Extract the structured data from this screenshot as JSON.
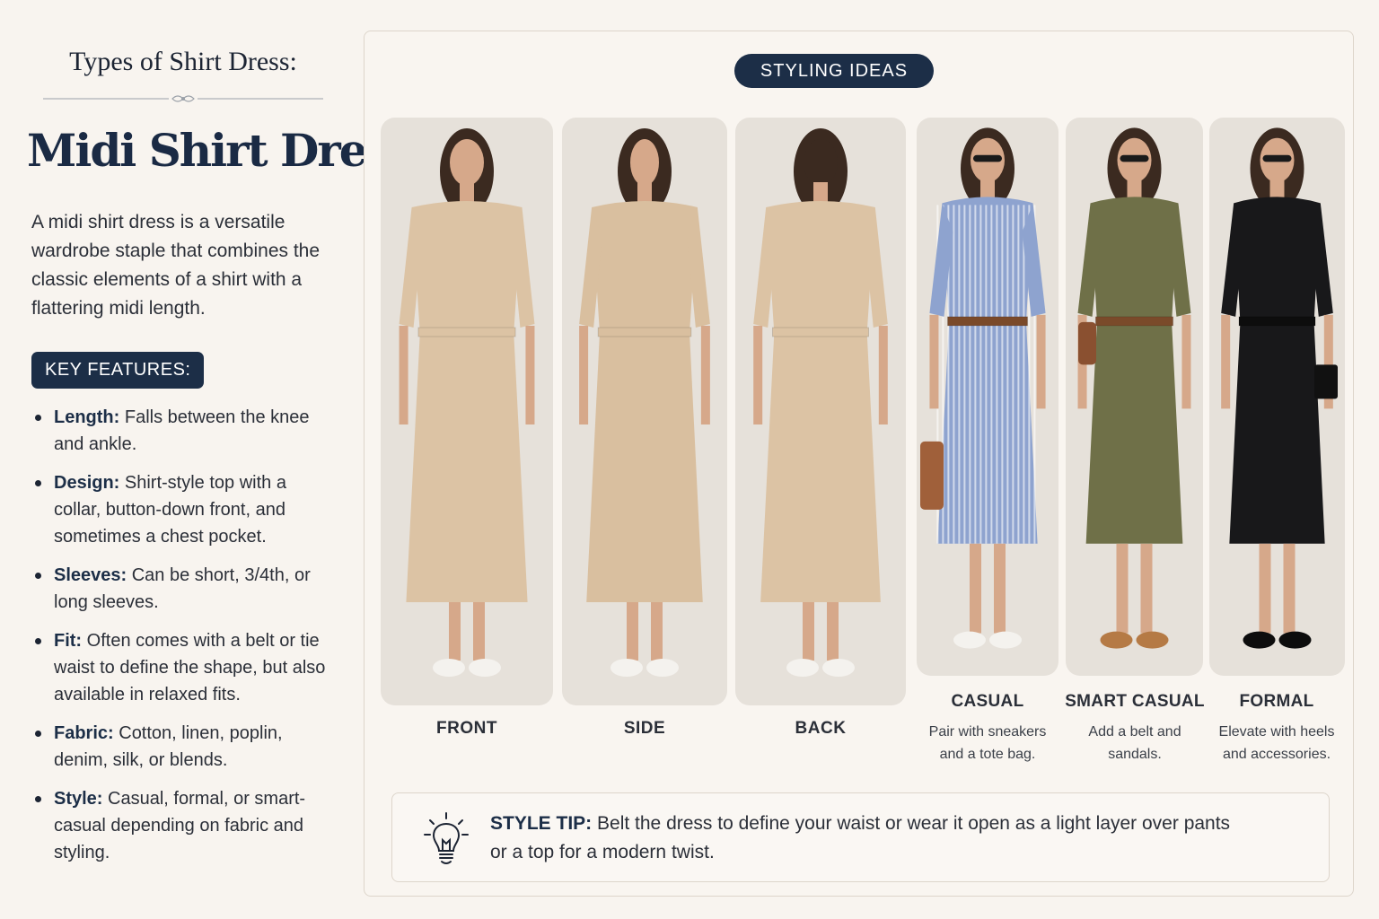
{
  "left": {
    "eyebrow": "Types of Shirt Dress:",
    "title": "Midi Shirt Dress",
    "intro": "A midi shirt dress is a versatile wardrobe staple that combines the classic elements of a shirt with a flattering midi length.",
    "key_features_label": "KEY FEATURES:",
    "features": [
      {
        "term": "Length:",
        "text": " Falls between the knee and ankle."
      },
      {
        "term": "Design:",
        "text": " Shirt-style top with a collar, button-down front, and sometimes a chest pocket."
      },
      {
        "term": "Sleeves:",
        "text": " Can be short, 3/4th, or long sleeves."
      },
      {
        "term": "Fit:",
        "text": " Often comes with a belt or tie waist to define the shape, but also available in relaxed fits."
      },
      {
        "term": "Fabric:",
        "text": " Cotton, linen, poplin, denim, silk, or blends."
      },
      {
        "term": "Style:",
        "text": " Casual, formal, or smart-casual depending on fabric and styling."
      }
    ]
  },
  "right": {
    "badge": "STYLING IDEAS",
    "views": [
      {
        "label": "FRONT",
        "dress_color": "#dcc3a4"
      },
      {
        "label": "SIDE",
        "dress_color": "#d9bf9f"
      },
      {
        "label": "BACK",
        "dress_color": "#dcc3a4"
      }
    ],
    "styles": [
      {
        "title": "CASUAL",
        "desc_line1": "Pair with sneakers",
        "desc_line2": "and a tote bag.",
        "dress_color": "#8ea3cf"
      },
      {
        "title": "SMART CASUAL",
        "desc_line1": "Add a belt and",
        "desc_line2": "sandals.",
        "dress_color": "#6f7048"
      },
      {
        "title": "FORMAL",
        "desc_line1": "Elevate with heels",
        "desc_line2": "and accessories.",
        "dress_color": "#18181a"
      }
    ],
    "tip": {
      "term": "STYLE TIP:",
      "text": " Belt the dress to define your waist or wear it open as a light layer over pants or a top for a modern twist."
    }
  },
  "colors": {
    "navy": "#1c2e47",
    "background": "#f8f4ef",
    "photo_background": "#e6e1da"
  },
  "icons": [
    "ornament-divider",
    "lightbulb-icon"
  ]
}
